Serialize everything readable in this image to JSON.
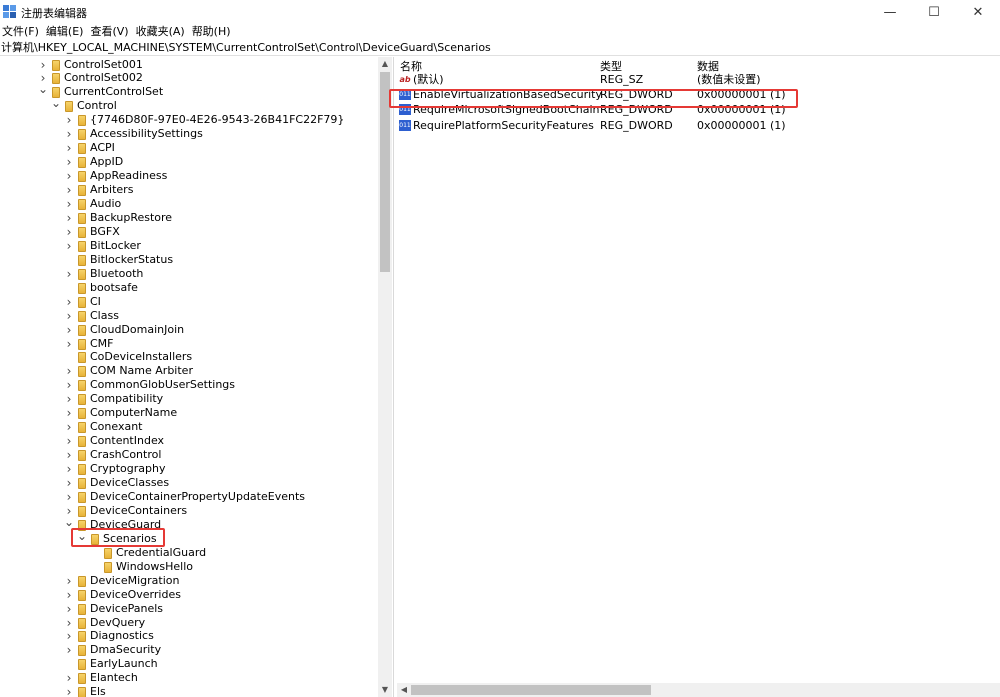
{
  "window": {
    "title": "注册表编辑器",
    "minimize_glyph": "—",
    "maximize_glyph": "☐",
    "close_glyph": "✕"
  },
  "menu": [
    "文件(F)",
    "编辑(E)",
    "查看(V)",
    "收藏夹(A)",
    "帮助(H)"
  ],
  "address": "计算机\\HKEY_LOCAL_MACHINE\\SYSTEM\\CurrentControlSet\\Control\\DeviceGuard\\Scenarios",
  "tree": [
    {
      "label": "ControlSet001",
      "depth": 0,
      "state": "collapsed"
    },
    {
      "label": "ControlSet002",
      "depth": 0,
      "state": "collapsed"
    },
    {
      "label": "CurrentControlSet",
      "depth": 0,
      "state": "expanded"
    },
    {
      "label": "Control",
      "depth": 1,
      "state": "expanded"
    },
    {
      "label": "{7746D80F-97E0-4E26-9543-26B41FC22F79}",
      "depth": 2,
      "state": "collapsed"
    },
    {
      "label": "AccessibilitySettings",
      "depth": 2,
      "state": "collapsed"
    },
    {
      "label": "ACPI",
      "depth": 2,
      "state": "collapsed"
    },
    {
      "label": "AppID",
      "depth": 2,
      "state": "collapsed"
    },
    {
      "label": "AppReadiness",
      "depth": 2,
      "state": "collapsed"
    },
    {
      "label": "Arbiters",
      "depth": 2,
      "state": "collapsed"
    },
    {
      "label": "Audio",
      "depth": 2,
      "state": "collapsed"
    },
    {
      "label": "BackupRestore",
      "depth": 2,
      "state": "collapsed"
    },
    {
      "label": "BGFX",
      "depth": 2,
      "state": "collapsed"
    },
    {
      "label": "BitLocker",
      "depth": 2,
      "state": "collapsed"
    },
    {
      "label": "BitlockerStatus",
      "depth": 2,
      "state": "none"
    },
    {
      "label": "Bluetooth",
      "depth": 2,
      "state": "collapsed"
    },
    {
      "label": "bootsafe",
      "depth": 2,
      "state": "none"
    },
    {
      "label": "CI",
      "depth": 2,
      "state": "collapsed"
    },
    {
      "label": "Class",
      "depth": 2,
      "state": "collapsed"
    },
    {
      "label": "CloudDomainJoin",
      "depth": 2,
      "state": "collapsed"
    },
    {
      "label": "CMF",
      "depth": 2,
      "state": "collapsed"
    },
    {
      "label": "CoDeviceInstallers",
      "depth": 2,
      "state": "none"
    },
    {
      "label": "COM Name Arbiter",
      "depth": 2,
      "state": "collapsed"
    },
    {
      "label": "CommonGlobUserSettings",
      "depth": 2,
      "state": "collapsed"
    },
    {
      "label": "Compatibility",
      "depth": 2,
      "state": "collapsed"
    },
    {
      "label": "ComputerName",
      "depth": 2,
      "state": "collapsed"
    },
    {
      "label": "Conexant",
      "depth": 2,
      "state": "collapsed"
    },
    {
      "label": "ContentIndex",
      "depth": 2,
      "state": "collapsed"
    },
    {
      "label": "CrashControl",
      "depth": 2,
      "state": "collapsed"
    },
    {
      "label": "Cryptography",
      "depth": 2,
      "state": "collapsed"
    },
    {
      "label": "DeviceClasses",
      "depth": 2,
      "state": "collapsed"
    },
    {
      "label": "DeviceContainerPropertyUpdateEvents",
      "depth": 2,
      "state": "collapsed"
    },
    {
      "label": "DeviceContainers",
      "depth": 2,
      "state": "collapsed"
    },
    {
      "label": "DeviceGuard",
      "depth": 2,
      "state": "expanded"
    },
    {
      "label": "Scenarios",
      "depth": 3,
      "state": "expanded",
      "selected": true
    },
    {
      "label": "CredentialGuard",
      "depth": 4,
      "state": "none"
    },
    {
      "label": "WindowsHello",
      "depth": 4,
      "state": "none"
    },
    {
      "label": "DeviceMigration",
      "depth": 2,
      "state": "collapsed"
    },
    {
      "label": "DeviceOverrides",
      "depth": 2,
      "state": "collapsed"
    },
    {
      "label": "DevicePanels",
      "depth": 2,
      "state": "collapsed"
    },
    {
      "label": "DevQuery",
      "depth": 2,
      "state": "collapsed"
    },
    {
      "label": "Diagnostics",
      "depth": 2,
      "state": "collapsed"
    },
    {
      "label": "DmaSecurity",
      "depth": 2,
      "state": "collapsed"
    },
    {
      "label": "EarlyLaunch",
      "depth": 2,
      "state": "none"
    },
    {
      "label": "Elantech",
      "depth": 2,
      "state": "collapsed"
    },
    {
      "label": "Els",
      "depth": 2,
      "state": "collapsed"
    }
  ],
  "values_header": {
    "name": "名称",
    "type": "类型",
    "data": "数据"
  },
  "values": [
    {
      "icon": "string-value-icon",
      "icon_text": "ab",
      "name": "(默认)",
      "type": "REG_SZ",
      "data": "(数值未设置)"
    },
    {
      "icon": "dword-value-icon",
      "icon_text": "011",
      "name": "EnableVirtualizationBasedSecurity",
      "type": "REG_DWORD",
      "data": "0x00000001 (1)",
      "highlighted": true
    },
    {
      "icon": "dword-value-icon",
      "icon_text": "011",
      "name": "RequireMicrosoftSignedBootChain",
      "type": "REG_DWORD",
      "data": "0x00000001 (1)"
    },
    {
      "icon": "dword-value-icon",
      "icon_text": "011",
      "name": "RequirePlatformSecurityFeatures",
      "type": "REG_DWORD",
      "data": "0x00000001 (1)"
    }
  ],
  "colors": {
    "highlight_box": "#e53935",
    "folder": "#f0c14b",
    "dword_icon": "#2d5fd0"
  }
}
